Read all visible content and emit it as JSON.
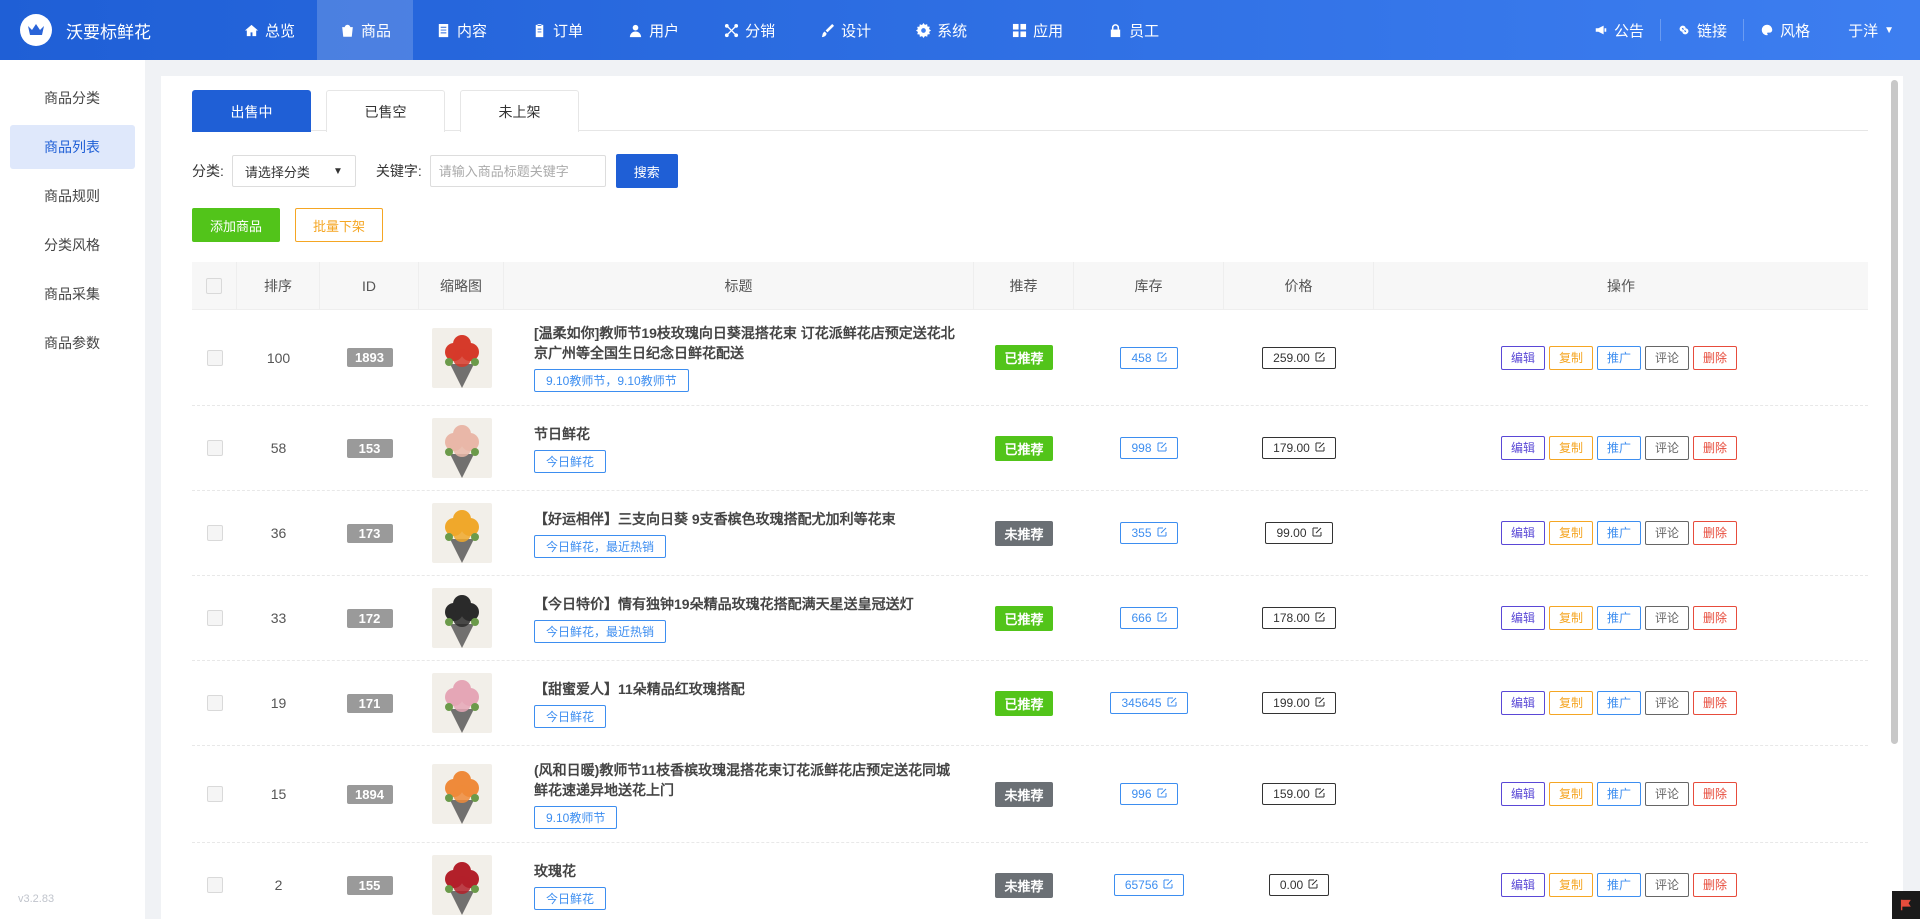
{
  "brand": {
    "name": "沃要标鲜花"
  },
  "nav": [
    {
      "label": "总览",
      "icon": "home-icon"
    },
    {
      "label": "商品",
      "icon": "bag-icon",
      "active": true
    },
    {
      "label": "内容",
      "icon": "document-icon"
    },
    {
      "label": "订单",
      "icon": "clipboard-icon"
    },
    {
      "label": "用户",
      "icon": "user-icon"
    },
    {
      "label": "分销",
      "icon": "network-icon"
    },
    {
      "label": "设计",
      "icon": "brush-icon"
    },
    {
      "label": "系统",
      "icon": "gear-icon"
    },
    {
      "label": "应用",
      "icon": "grid-icon"
    },
    {
      "label": "员工",
      "icon": "lock-icon"
    }
  ],
  "topright": {
    "notice": "公告",
    "link": "链接",
    "style": "风格",
    "user": "于洋"
  },
  "sidebar": {
    "items": [
      {
        "label": "商品分类"
      },
      {
        "label": "商品列表",
        "active": true
      },
      {
        "label": "商品规则"
      },
      {
        "label": "分类风格"
      },
      {
        "label": "商品采集"
      },
      {
        "label": "商品参数"
      }
    ],
    "version": "v3.2.83"
  },
  "tabs": [
    {
      "label": "出售中",
      "active": true
    },
    {
      "label": "已售空"
    },
    {
      "label": "未上架"
    }
  ],
  "filter": {
    "category_label": "分类:",
    "category_value": "请选择分类",
    "keyword_label": "关键字:",
    "keyword_placeholder": "请输入商品标题关键字",
    "search_label": "搜索"
  },
  "actions": {
    "add_label": "添加商品",
    "batch_label": "批量下架"
  },
  "table": {
    "headers": {
      "sort": "排序",
      "id": "ID",
      "thumb": "缩略图",
      "title": "标题",
      "recommend": "推荐",
      "stock": "库存",
      "price": "价格",
      "ops": "操作"
    },
    "op_labels": {
      "edit": "编辑",
      "copy": "复制",
      "promote": "推广",
      "review": "评论",
      "delete": "删除"
    },
    "rows": [
      {
        "sort": "100",
        "id": "1893",
        "title": "[温柔如你]教师节19枝玫瑰向日葵混搭花束 订花派鲜花店预定送花北京广州等全国生日纪念日鲜花配送",
        "tag": "9.10教师节，9.10教师节",
        "recommend": "已推荐",
        "rec_on": true,
        "stock": "458",
        "price": "259.00",
        "thumb_color": "#d63a2a"
      },
      {
        "sort": "58",
        "id": "153",
        "title": "节日鲜花",
        "tag": "今日鲜花",
        "recommend": "已推荐",
        "rec_on": true,
        "stock": "998",
        "price": "179.00",
        "thumb_color": "#e9b7a8"
      },
      {
        "sort": "36",
        "id": "173",
        "title": "【好运相伴】三支向日葵 9支香槟色玫瑰搭配尤加利等花束",
        "tag": "今日鲜花，最近热销",
        "recommend": "未推荐",
        "rec_on": false,
        "stock": "355",
        "price": "99.00",
        "thumb_color": "#f0a82b"
      },
      {
        "sort": "33",
        "id": "172",
        "title": "【今日特价】情有独钟19朵精品玫瑰花搭配满天星送皇冠送灯",
        "tag": "今日鲜花，最近热销",
        "recommend": "已推荐",
        "rec_on": true,
        "stock": "666",
        "price": "178.00",
        "thumb_color": "#2a2a2a"
      },
      {
        "sort": "19",
        "id": "171",
        "title": "【甜蜜爱人】11朵精品红玫瑰搭配",
        "tag": "今日鲜花",
        "recommend": "已推荐",
        "rec_on": true,
        "stock": "345645",
        "price": "199.00",
        "thumb_color": "#e5a6b6"
      },
      {
        "sort": "15",
        "id": "1894",
        "title": "(风和日暖)教师节11枝香槟玫瑰混搭花束订花派鲜花店预定送花同城鲜花速递异地送花上门",
        "tag": "9.10教师节",
        "recommend": "未推荐",
        "rec_on": false,
        "stock": "996",
        "price": "159.00",
        "thumb_color": "#ef8a3a"
      },
      {
        "sort": "2",
        "id": "155",
        "title": "玫瑰花",
        "tag": "今日鲜花",
        "recommend": "未推荐",
        "rec_on": false,
        "stock": "65756",
        "price": "0.00",
        "thumb_color": "#b3202a"
      }
    ]
  }
}
